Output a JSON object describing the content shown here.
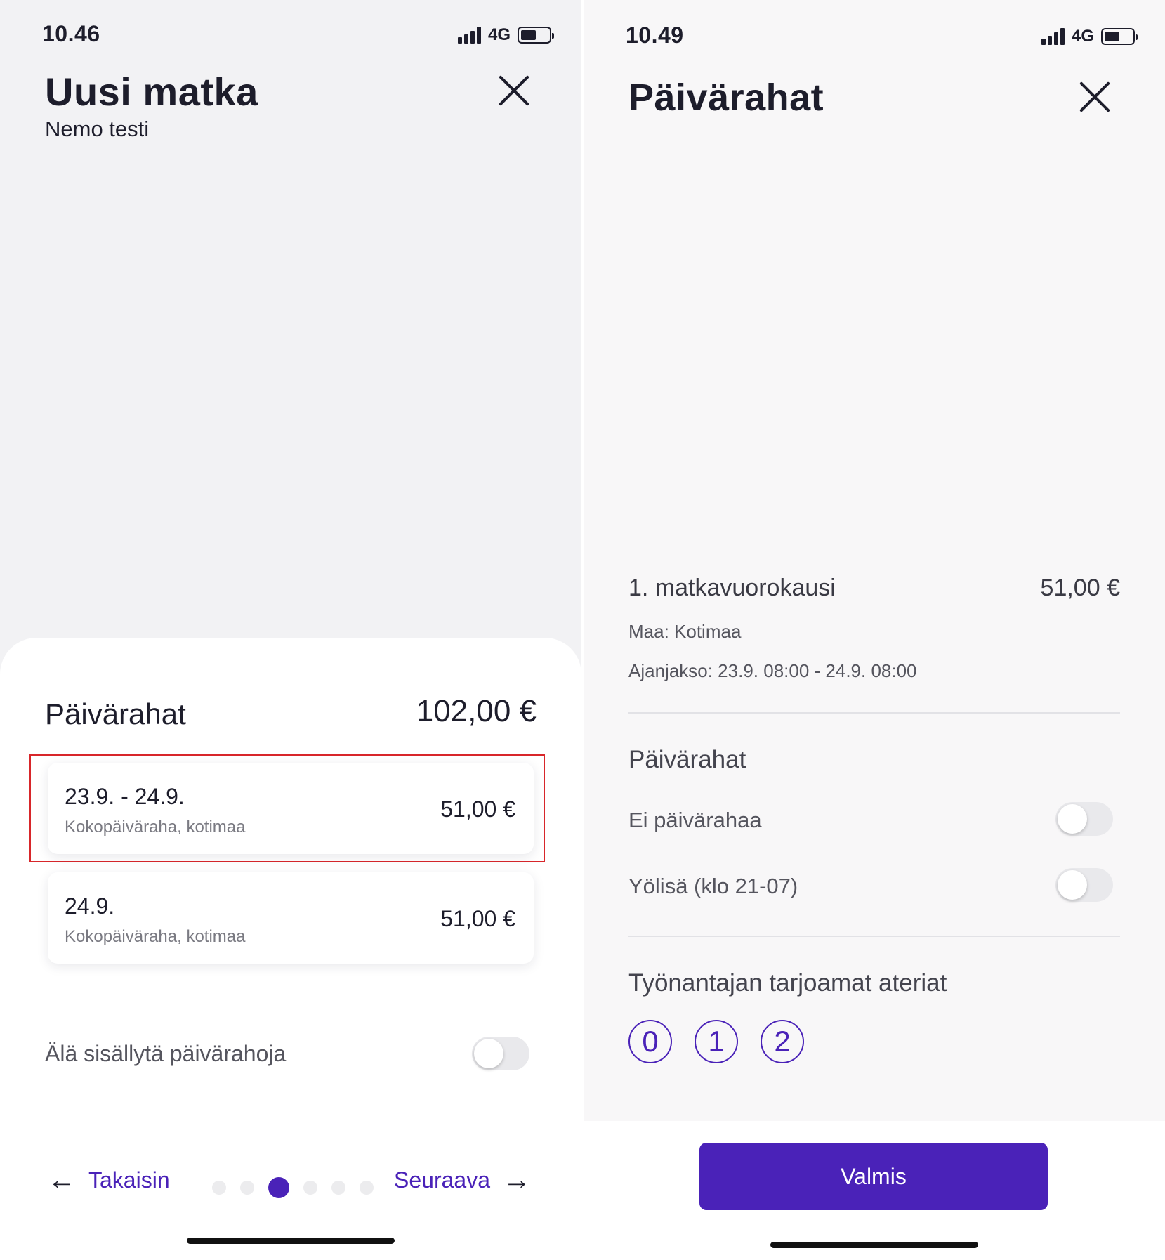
{
  "left": {
    "status": {
      "time": "10.46",
      "network": "4G"
    },
    "header": {
      "title": "Uusi matka",
      "subtitle": "Nemo testi"
    },
    "sheet": {
      "title": "Päivärahat",
      "total": "102,00 €",
      "items": [
        {
          "date": "23.9. - 24.9.",
          "description": "Kokopäiväraha, kotimaa",
          "amount": "51,00 €"
        },
        {
          "date": "24.9.",
          "description": "Kokopäiväraha, kotimaa",
          "amount": "51,00 €"
        }
      ],
      "exclude_label": "Älä sisällytä päivärahoja",
      "exclude_enabled": false
    },
    "nav": {
      "back_label": "Takaisin",
      "next_label": "Seuraava",
      "step_count": 6,
      "current_step": 3
    },
    "colors": {
      "accent": "#4a22b8",
      "highlight": "#d8262a"
    }
  },
  "right": {
    "status": {
      "time": "10.49",
      "network": "4G"
    },
    "header": {
      "title": "Päivärahat"
    },
    "day": {
      "title": "1. matkavuorokausi",
      "amount": "51,00 €",
      "country": "Maa: Kotimaa",
      "period": "Ajanjakso: 23.9. 08:00 - 24.9. 08:00"
    },
    "allowances": {
      "heading": "Päivärahat",
      "no_allowance_label": "Ei päivärahaa",
      "no_allowance_enabled": false,
      "night_label": "Yölisä (klo 21-07)",
      "night_enabled": false
    },
    "meals": {
      "heading": "Työnantajan tarjoamat ateriat",
      "options": [
        "0",
        "1",
        "2"
      ]
    },
    "done_label": "Valmis",
    "colors": {
      "accent": "#4a22b8"
    }
  }
}
